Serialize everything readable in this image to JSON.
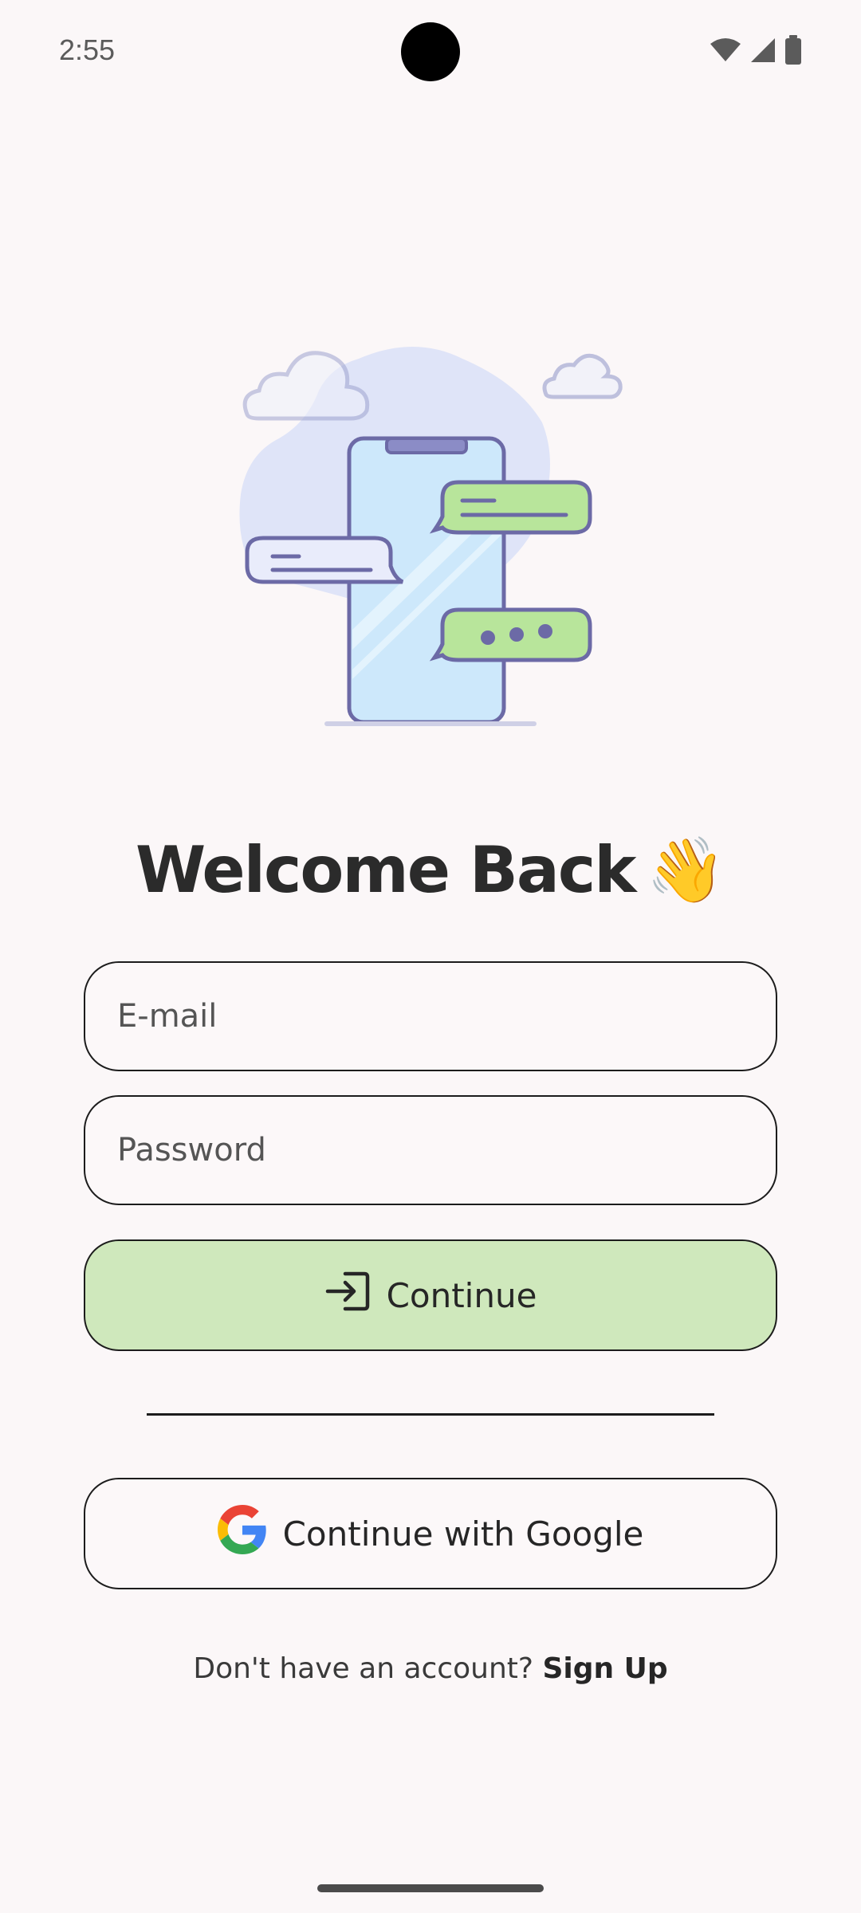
{
  "status_bar": {
    "time": "2:55",
    "icons": [
      "wifi-icon",
      "cellular-signal-icon",
      "battery-icon"
    ]
  },
  "illustration": {
    "name": "phone-chat-illustration"
  },
  "header": {
    "title": "Welcome Back",
    "emoji": "👋"
  },
  "form": {
    "email_placeholder": "E-mail",
    "email_value": "",
    "password_placeholder": "Password",
    "password_value": "",
    "continue_label": "Continue",
    "continue_icon": "login-arrow-icon"
  },
  "social": {
    "google_label": "Continue with Google",
    "google_icon": "google-logo-icon"
  },
  "footer": {
    "prompt": "Don't have an account?",
    "signup_label": "Sign Up"
  },
  "colors": {
    "background": "#fbf7f8",
    "continue_button": "#cfe8bc",
    "border": "#1c1c1c",
    "text": "#2b2b2b"
  }
}
